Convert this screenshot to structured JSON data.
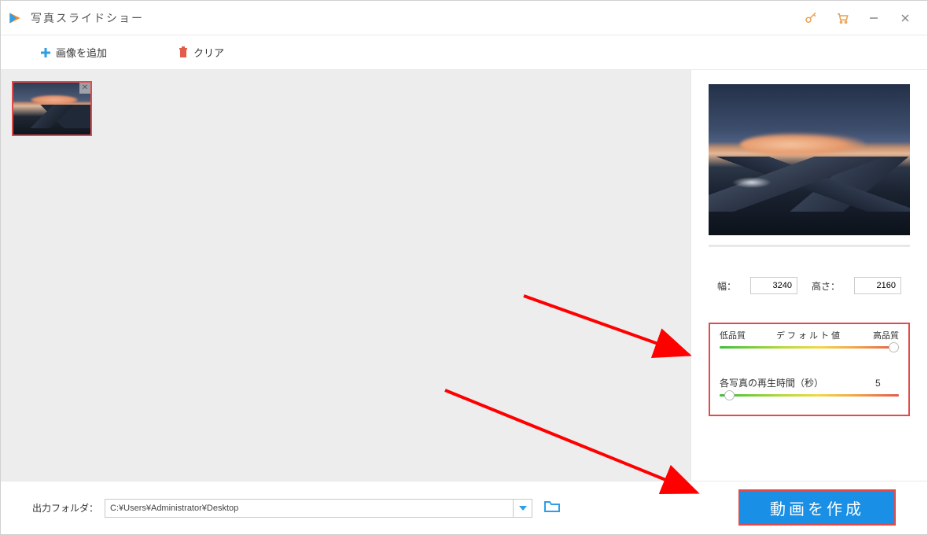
{
  "app": {
    "title": "写真スライドショー"
  },
  "toolbar": {
    "add_label": "画像を追加",
    "clear_label": "クリア"
  },
  "dimensions": {
    "width_label": "幅：",
    "width_value": "3240",
    "height_label": "高さ：",
    "height_value": "2160"
  },
  "quality": {
    "low": "低品質",
    "default": "デフォルト値",
    "high": "高品質"
  },
  "duration": {
    "label": "各写真の再生時間（秒）",
    "value": "5"
  },
  "footer": {
    "out_label": "出力フォルダ：",
    "out_path": "C:¥Users¥Administrator¥Desktop",
    "create_label": "動画を作成"
  }
}
